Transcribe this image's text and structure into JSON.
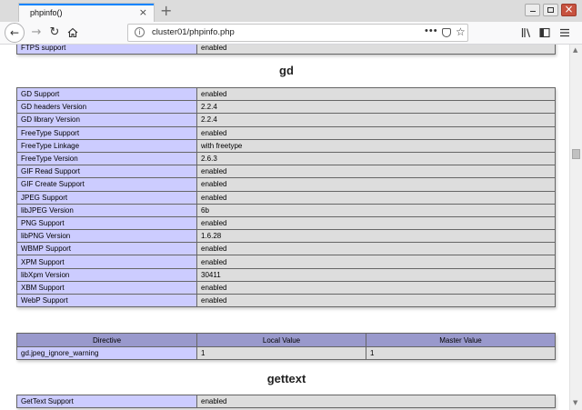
{
  "browser": {
    "tab_title": "phpinfo()",
    "tab_close": "×",
    "new_tab": "+",
    "url": "cluster01/phpinfo.php"
  },
  "icons": {
    "back": "back-arrow-icon",
    "forward": "forward-arrow-icon",
    "reload": "reload-icon",
    "home": "home-icon",
    "library": "library-icon",
    "sidebar": "sidebar-icon",
    "menu": "hamburger-menu-icon"
  },
  "top_row": {
    "label": "FTPS support",
    "value": "enabled"
  },
  "gd": {
    "heading": "gd",
    "rows": [
      {
        "label": "GD Support",
        "value": "enabled"
      },
      {
        "label": "GD headers Version",
        "value": "2.2.4"
      },
      {
        "label": "GD library Version",
        "value": "2.2.4"
      },
      {
        "label": "FreeType Support",
        "value": "enabled"
      },
      {
        "label": "FreeType Linkage",
        "value": "with freetype"
      },
      {
        "label": "FreeType Version",
        "value": "2.6.3"
      },
      {
        "label": "GIF Read Support",
        "value": "enabled"
      },
      {
        "label": "GIF Create Support",
        "value": "enabled"
      },
      {
        "label": "JPEG Support",
        "value": "enabled"
      },
      {
        "label": "libJPEG Version",
        "value": "6b"
      },
      {
        "label": "PNG Support",
        "value": "enabled"
      },
      {
        "label": "libPNG Version",
        "value": "1.6.28"
      },
      {
        "label": "WBMP Support",
        "value": "enabled"
      },
      {
        "label": "XPM Support",
        "value": "enabled"
      },
      {
        "label": "libXpm Version",
        "value": "30411"
      },
      {
        "label": "XBM Support",
        "value": "enabled"
      },
      {
        "label": "WebP Support",
        "value": "enabled"
      }
    ],
    "directives": {
      "headers": [
        "Directive",
        "Local Value",
        "Master Value"
      ],
      "rows": [
        {
          "name": "gd.jpeg_ignore_warning",
          "local": "1",
          "master": "1"
        }
      ]
    }
  },
  "gettext": {
    "heading": "gettext",
    "rows": [
      {
        "label": "GetText Support",
        "value": "enabled"
      }
    ]
  },
  "colors": {
    "label_cell": "#ccccff",
    "value_cell": "#dddddd",
    "header_cell": "#9999cc",
    "tab_accent": "#0a84ff"
  }
}
